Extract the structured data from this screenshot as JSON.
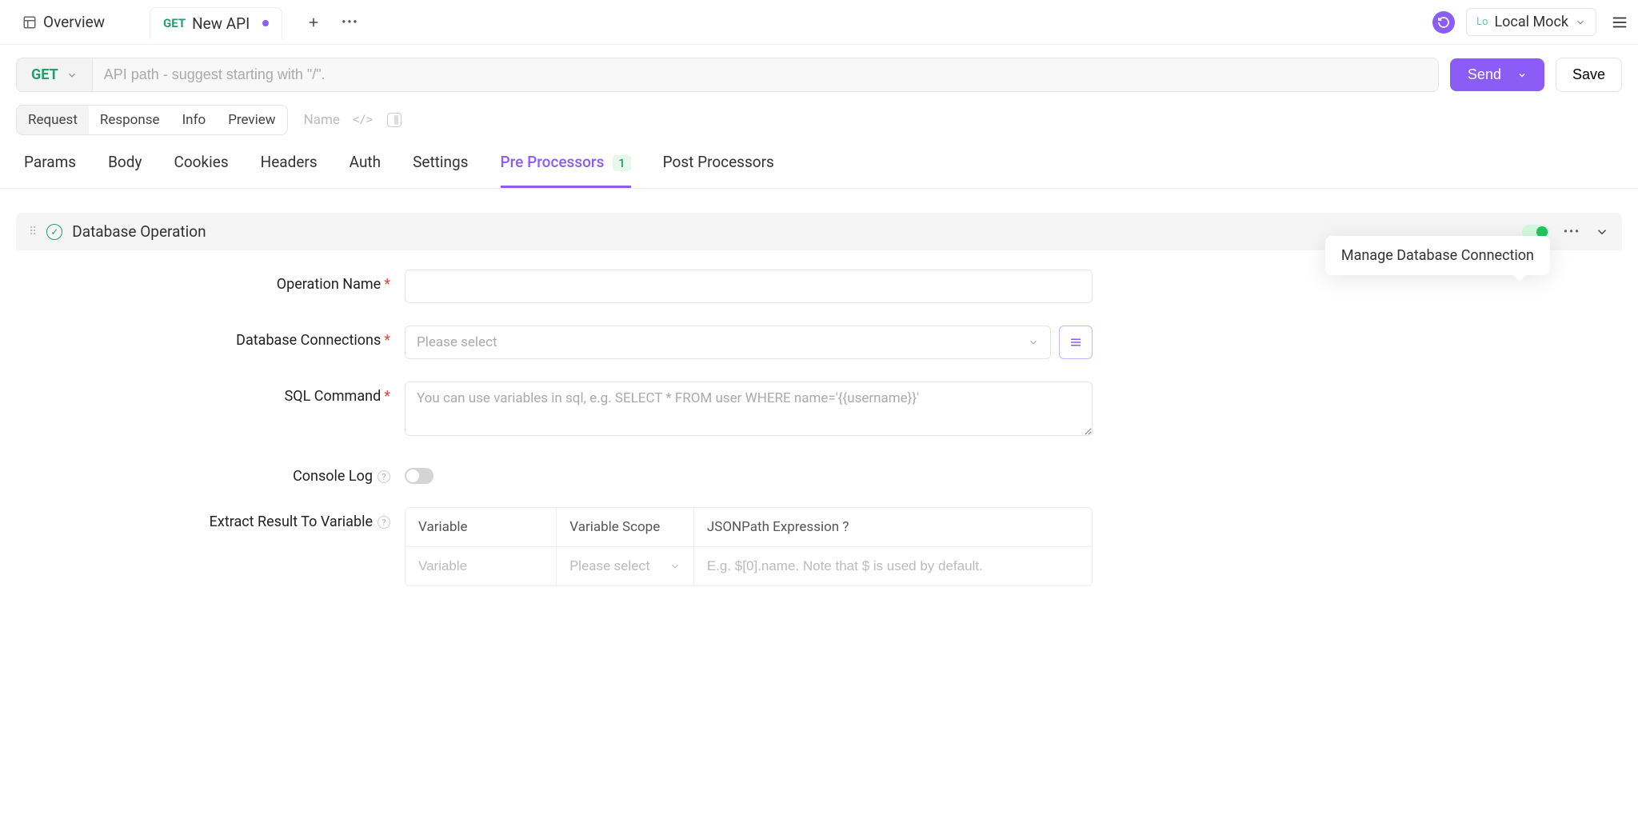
{
  "top": {
    "overview": "Overview",
    "api_method": "GET",
    "api_title": "New API",
    "env_prefix": "Lo",
    "env": "Local Mock"
  },
  "request_bar": {
    "method": "GET",
    "url_placeholder": "API path - suggest starting with \"/\".",
    "send": "Send",
    "save": "Save"
  },
  "view_tabs": {
    "request": "Request",
    "response": "Response",
    "info": "Info",
    "preview": "Preview",
    "name": "Name"
  },
  "sub_tabs": {
    "params": "Params",
    "body": "Body",
    "cookies": "Cookies",
    "headers": "Headers",
    "auth": "Auth",
    "settings": "Settings",
    "pre": "Pre Processors",
    "pre_badge": "1",
    "post": "Post Processors"
  },
  "panel": {
    "title": "Database Operation",
    "tooltip": "Manage Database Connection",
    "labels": {
      "operation_name": "Operation Name",
      "db_connections": "Database Connections",
      "sql_command": "SQL Command",
      "console_log": "Console Log",
      "extract": "Extract Result To Variable"
    },
    "placeholders": {
      "select": "Please select",
      "sql": "You can use variables in sql, e.g. SELECT * FROM user WHERE name='{{username}}'",
      "variable": "Variable",
      "jsonpath": "E.g. $[0].name. Note that $ is used by default."
    },
    "table_headers": {
      "variable": "Variable",
      "scope": "Variable Scope",
      "jsonpath": "JSONPath Expression"
    }
  }
}
